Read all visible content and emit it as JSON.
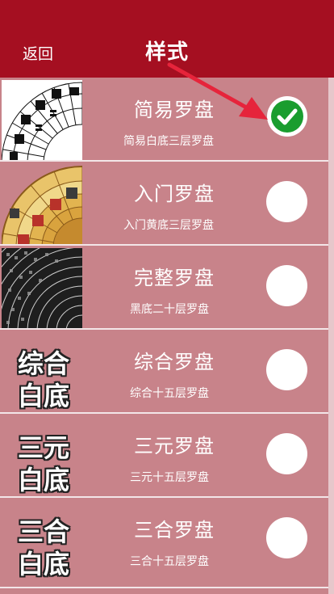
{
  "header": {
    "back_label": "返回",
    "title": "样式"
  },
  "colors": {
    "header_bg": "#a50f21",
    "row_bg": "#c8838a",
    "check_green": "#1a9d2f",
    "arrow_red": "#e6243b"
  },
  "styles": [
    {
      "name": "简易罗盘",
      "desc": "简易白底三层罗盘",
      "selected": true,
      "thumb": "compass-white-image"
    },
    {
      "name": "入门罗盘",
      "desc": "入门黄底三层罗盘",
      "selected": false,
      "thumb": "compass-gold-image"
    },
    {
      "name": "完整罗盘",
      "desc": "黑底二十层罗盘",
      "selected": false,
      "thumb": "compass-black-image"
    },
    {
      "name": "综合罗盘",
      "desc": "综合十五层罗盘",
      "selected": false,
      "thumb_line1": "综合",
      "thumb_line2": "白底"
    },
    {
      "name": "三元罗盘",
      "desc": "三元十五层罗盘",
      "selected": false,
      "thumb_line1": "三元",
      "thumb_line2": "白底"
    },
    {
      "name": "三合罗盘",
      "desc": "三合十五层罗盘",
      "selected": false,
      "thumb_line1": "三合",
      "thumb_line2": "白底"
    }
  ]
}
